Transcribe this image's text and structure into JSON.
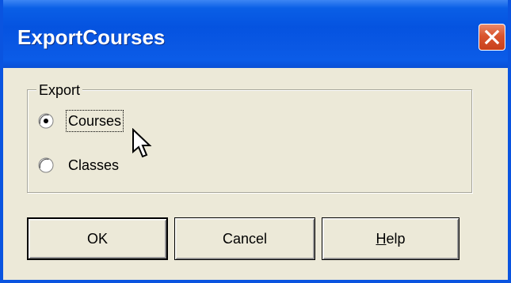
{
  "window": {
    "title": "ExportCourses",
    "close_icon": "close-icon",
    "colors": {
      "titlebar": "#0553e0",
      "close_button": "#d9542d",
      "dialog_background": "#ece9d8"
    }
  },
  "export_group": {
    "legend": "Export",
    "options": [
      {
        "label": "Courses",
        "selected": true,
        "focused": true
      },
      {
        "label": "Classes",
        "selected": false,
        "focused": false
      }
    ]
  },
  "buttons": {
    "ok_label": "OK",
    "cancel_label": "Cancel",
    "help_label_mnemonic": "H",
    "help_label_rest": "elp"
  },
  "cursor": {
    "icon": "mouse-pointer-icon"
  }
}
